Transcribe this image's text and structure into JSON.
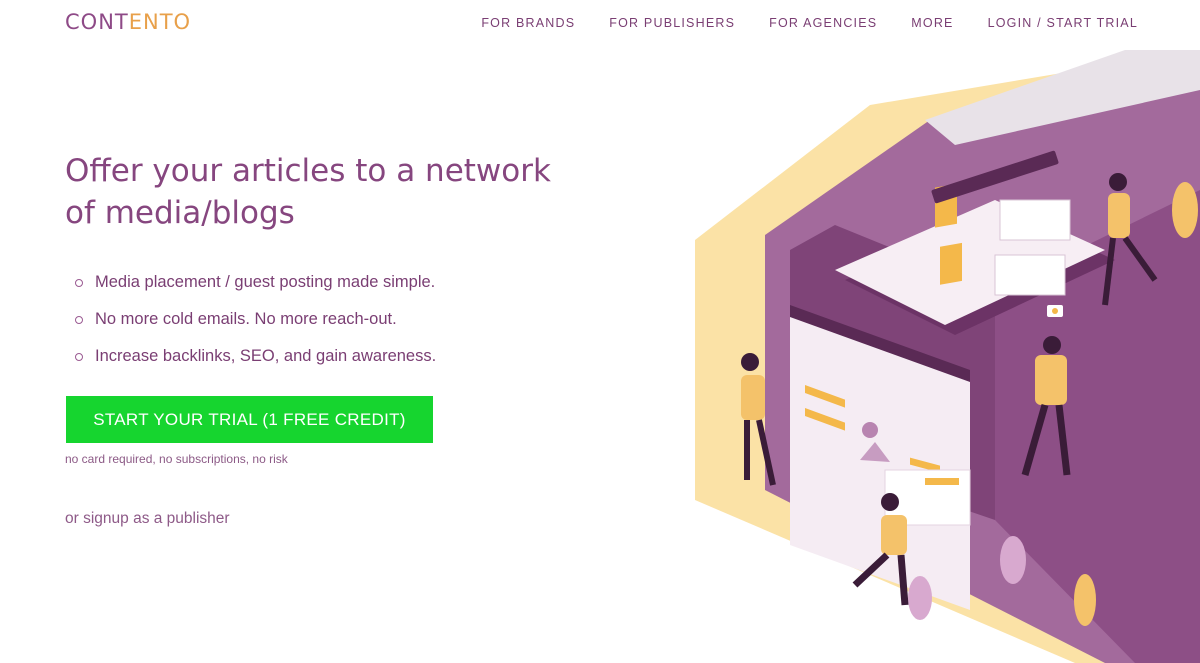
{
  "brand": {
    "logo_part1": "CONT",
    "logo_part2": "ENTO"
  },
  "nav": {
    "items": [
      {
        "label": "FOR BRANDS"
      },
      {
        "label": "FOR PUBLISHERS"
      },
      {
        "label": "FOR AGENCIES"
      },
      {
        "label": "MORE"
      },
      {
        "label": "LOGIN / START TRIAL"
      }
    ]
  },
  "hero": {
    "headline_line1": "Offer your articles to a network",
    "headline_line2": "of media/blogs",
    "bullets": [
      "Media placement / guest posting made simple.",
      "No more cold emails. No more reach-out.",
      "Increase backlinks, SEO, and gain awareness."
    ],
    "cta_label": "START YOUR TRIAL (1 FREE CREDIT)",
    "cta_note": "no card required, no subscriptions, no risk",
    "publisher_link": "or signup as a publisher"
  },
  "colors": {
    "brand_purple": "#86467f",
    "brand_orange": "#e8a04a",
    "cta_green": "#16d52f",
    "illustration_purple": "#8d4f86",
    "illustration_yellow": "#f9d88a"
  }
}
